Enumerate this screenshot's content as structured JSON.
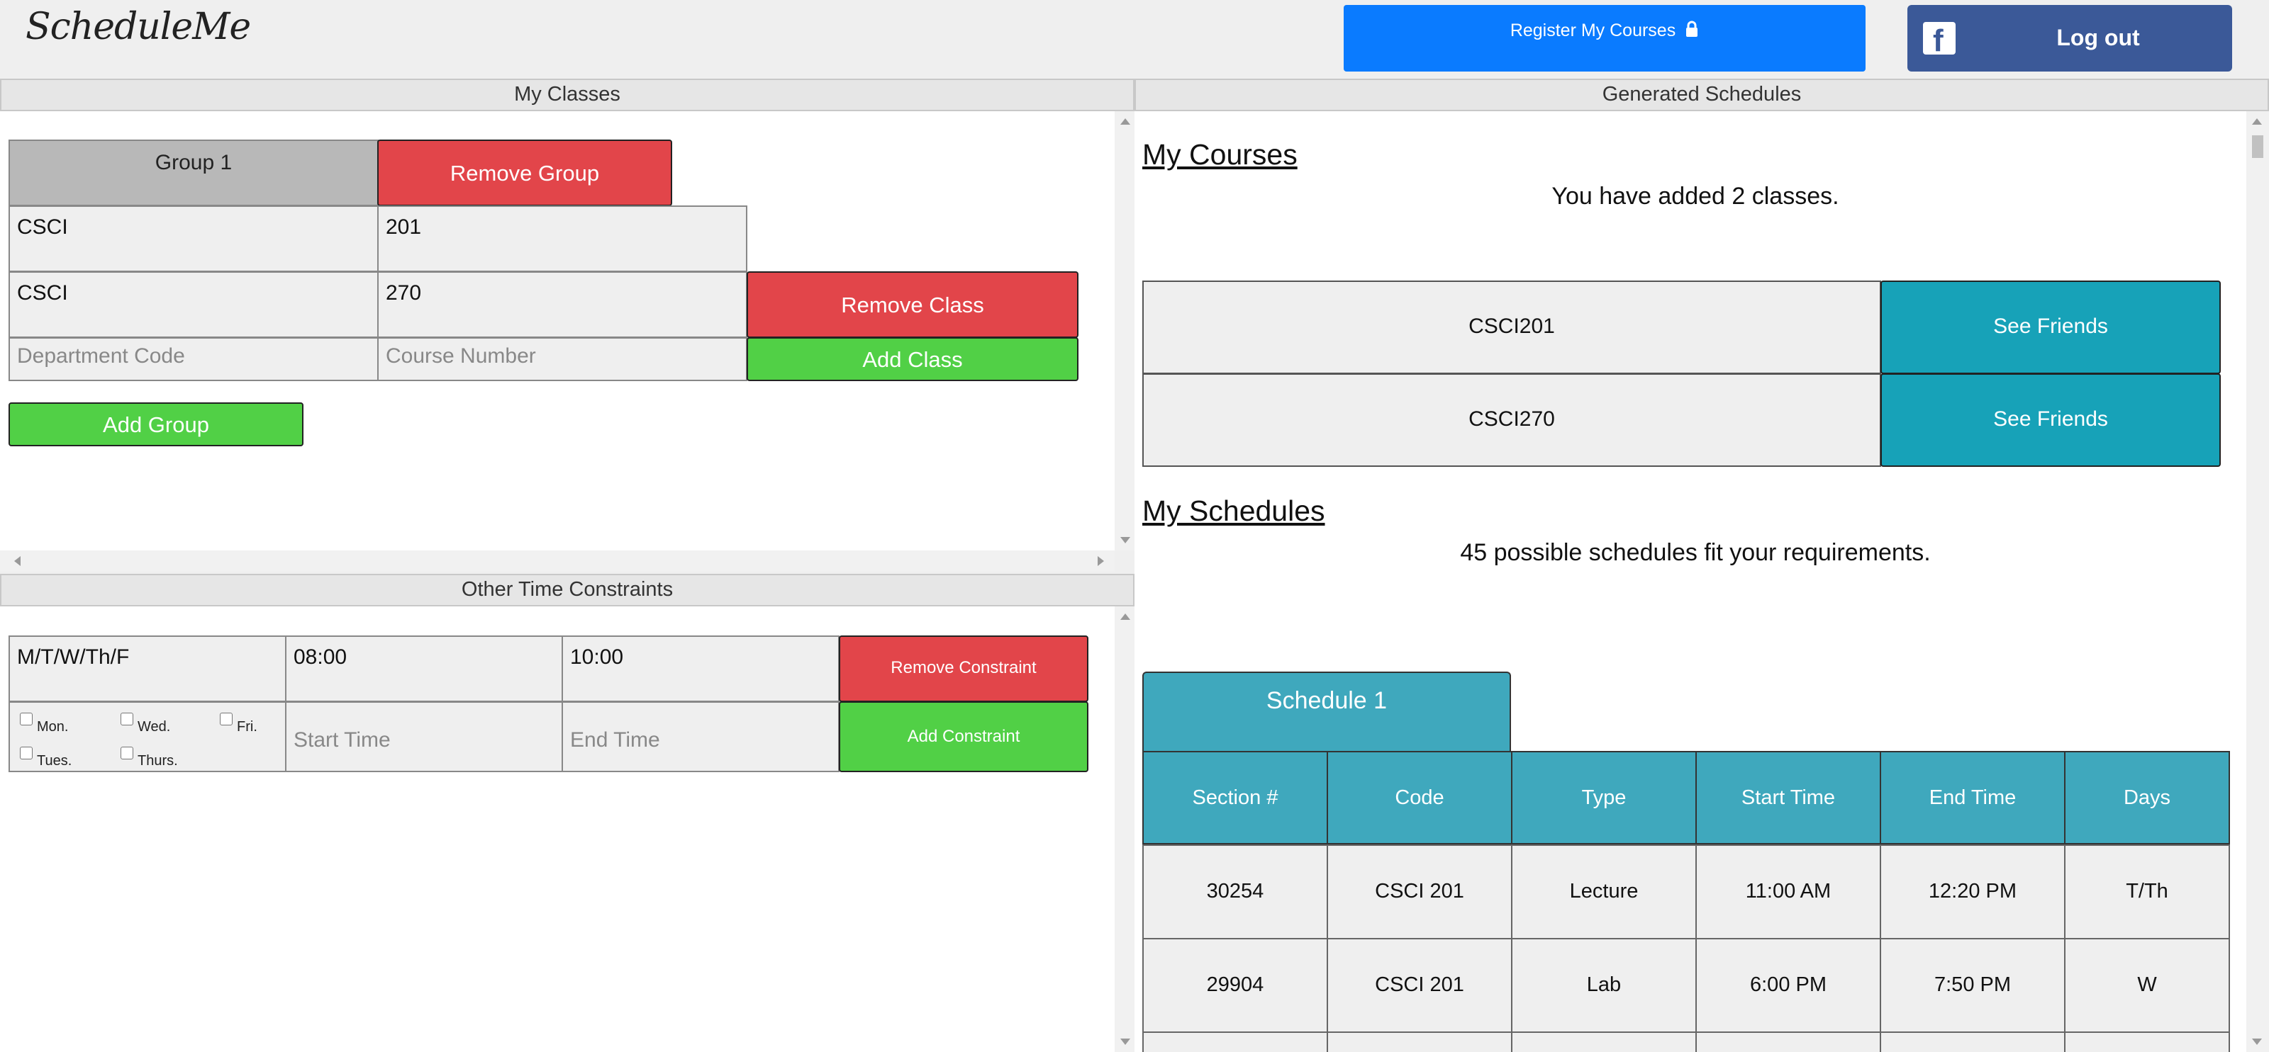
{
  "header": {
    "logo": "ScheduleMe",
    "register_label": "Register My Courses",
    "logout_label": "Log out"
  },
  "my_classes": {
    "title": "My Classes",
    "group_label": "Group 1",
    "remove_group_label": "Remove Group",
    "classes": [
      {
        "dept": "CSCI",
        "number": "201"
      },
      {
        "dept": "CSCI",
        "number": "270"
      }
    ],
    "remove_class_label": "Remove Class",
    "dept_placeholder": "Department Code",
    "number_placeholder": "Course Number",
    "add_class_label": "Add Class",
    "add_group_label": "Add Group"
  },
  "constraints": {
    "title": "Other Time Constraints",
    "existing": {
      "days": "M/T/W/Th/F",
      "start": "08:00",
      "end": "10:00"
    },
    "remove_label": "Remove Constraint",
    "days": [
      "Mon.",
      "Wed.",
      "Fri.",
      "Tues.",
      "Thurs."
    ],
    "start_placeholder": "Start Time",
    "end_placeholder": "End Time",
    "add_label": "Add Constraint"
  },
  "generated": {
    "title": "Generated Schedules",
    "my_courses_heading": "My Courses",
    "added_text": "You have added 2 classes.",
    "courses": [
      {
        "code": "CSCI201",
        "friends_label": "See Friends"
      },
      {
        "code": "CSCI270",
        "friends_label": "See Friends"
      }
    ],
    "my_schedules_heading": "My Schedules",
    "possible_text": "45 possible schedules fit your requirements.",
    "schedule_tab": "Schedule 1",
    "table_headers": [
      "Section #",
      "Code",
      "Type",
      "Start Time",
      "End Time",
      "Days"
    ],
    "rows": [
      [
        "30254",
        "CSCI 201",
        "Lecture",
        "11:00 AM",
        "12:20 PM",
        "T/Th"
      ],
      [
        "29904",
        "CSCI 201",
        "Lab",
        "6:00 PM",
        "7:50 PM",
        "W"
      ]
    ]
  },
  "colors": {
    "register": "#0a7bff",
    "facebook": "#3b5998",
    "red": "#e2454a",
    "green": "#51d046",
    "teal": "#17a2b8",
    "schedule_teal": "#3fa8bd"
  }
}
